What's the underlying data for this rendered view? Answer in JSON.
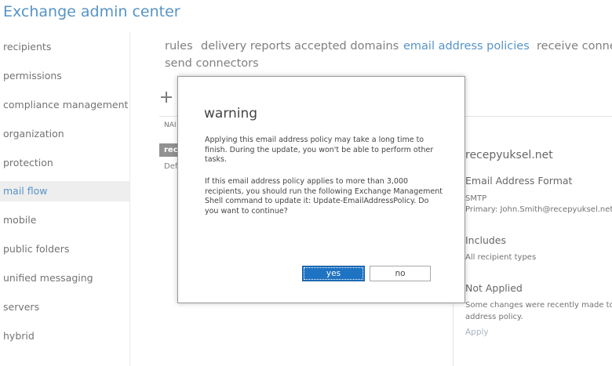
{
  "app": {
    "title": "Exchange admin center"
  },
  "sidebar": {
    "items": [
      {
        "label": "recipients"
      },
      {
        "label": "permissions"
      },
      {
        "label": "compliance management"
      },
      {
        "label": "organization"
      },
      {
        "label": "protection"
      },
      {
        "label": "mail flow",
        "active": true
      },
      {
        "label": "mobile"
      },
      {
        "label": "public folders"
      },
      {
        "label": "unified messaging"
      },
      {
        "label": "servers"
      },
      {
        "label": "hybrid"
      }
    ]
  },
  "tabs": [
    {
      "label": "rules"
    },
    {
      "label": "delivery reports"
    },
    {
      "label": "accepted domains"
    },
    {
      "label": "email address policies",
      "active": true
    },
    {
      "label": "receive conne"
    },
    {
      "label": "send connectors"
    }
  ],
  "list": {
    "column_header": "NAI",
    "selected_row": "rec",
    "row": "Def"
  },
  "details": {
    "title": "recepyuksel.net",
    "format_heading": "Email Address Format",
    "format_type": "SMTP",
    "format_value": "Primary: John.Smith@recepyuksel.net",
    "includes_heading": "Includes",
    "includes_value": "All recipient types",
    "status_heading": "Not Applied",
    "status_line1": "Some changes were recently made to th",
    "status_line2": "address policy.",
    "apply_link": "Apply"
  },
  "dialog": {
    "title": "warning",
    "paragraph1": "Applying this email address policy may take a long time to finish. During the update, you won't be able to perform other tasks.",
    "paragraph2": "If this email address policy applies to more than 3,000 recipients, you should run the following Exchange Management Shell command to update it: Update-EmailAddressPolicy. Do you want to continue?",
    "yes_label": "yes",
    "no_label": "no"
  },
  "colors": {
    "accent": "#1e6fb3",
    "primary_button": "#1f73c3"
  },
  "icons": {
    "add": "plus-icon"
  }
}
